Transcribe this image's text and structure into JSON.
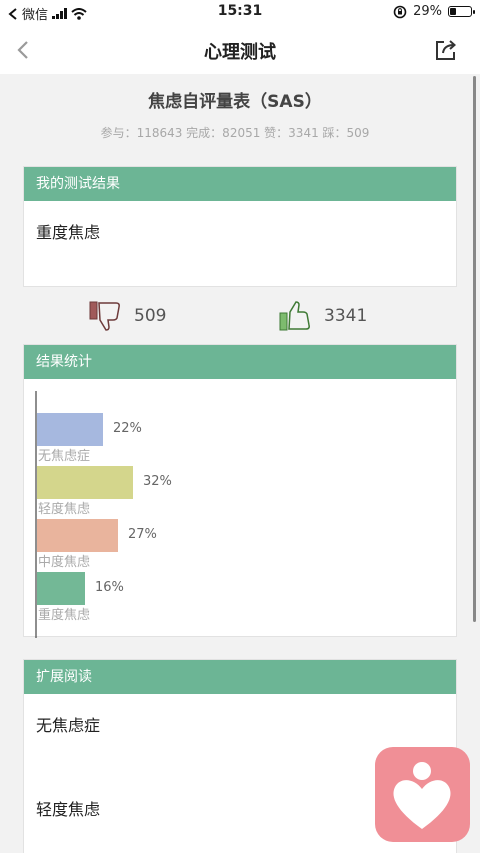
{
  "status_bar": {
    "carrier": "微信",
    "time": "15:31",
    "battery": "29%",
    "battery_level": 0.29,
    "icons": [
      "back-chevron-icon",
      "signal-icon",
      "wifi-icon",
      "orientation-lock-icon",
      "battery-icon"
    ]
  },
  "nav": {
    "title": "心理测试",
    "icons": [
      "back-icon",
      "share-icon"
    ]
  },
  "test": {
    "title": "焦虑自评量表（SAS）",
    "stats": "参与：118643 完成：82051 赞：3341 踩：509"
  },
  "result": {
    "heading": "我的测试结果",
    "text": "重度焦虑"
  },
  "votes": {
    "dislike_count": "509",
    "like_count": "3341",
    "icons": [
      "thumbs-down-icon",
      "thumbs-up-icon"
    ],
    "colors": {
      "down": "#a05a5a",
      "up": "#7dbb6e"
    }
  },
  "stats_section": {
    "heading": "结果统计"
  },
  "chart_data": {
    "type": "bar",
    "orientation": "horizontal",
    "categories": [
      "无焦虑症",
      "轻度焦虑",
      "中度焦虑",
      "重度焦虑"
    ],
    "values": [
      22,
      32,
      27,
      16
    ],
    "value_labels": [
      "22%",
      "32%",
      "27%",
      "16%"
    ],
    "colors": [
      "#a6b8df",
      "#d4d68c",
      "#e9b49d",
      "#73b896"
    ],
    "xlim": [
      0,
      100
    ]
  },
  "reading": {
    "heading": "扩展阅读",
    "items": [
      "无焦虑症",
      "轻度焦虑"
    ]
  },
  "fab": {
    "icon": "heart-person-icon",
    "color": "#f08f96"
  },
  "theme": {
    "accent": "#6cb595"
  }
}
